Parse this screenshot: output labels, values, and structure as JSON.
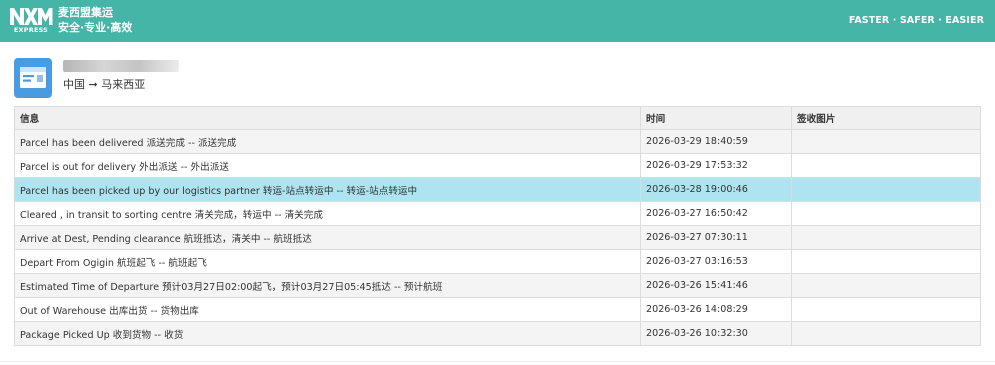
{
  "header": {
    "logo_text": "NXM",
    "logo_sub": "EXPRESS",
    "brand_name": "麦西盟集运",
    "slogan": "安全·专业·高效",
    "tagline": "FASTER · SAFER · EASIER",
    "background_color": "#44b5a6"
  },
  "shipment": {
    "icon": "package-card-icon",
    "tracking_number": "",
    "route": "中国 ➞ 马来西亚"
  },
  "table": {
    "columns": [
      "信息",
      "时间",
      "签收图片"
    ],
    "highlight_color": "#ade4f0",
    "rows": [
      {
        "info": "Parcel has been delivered 派送完成 -- 派送完成",
        "time": "2026-03-29 18:40:59",
        "sign": ""
      },
      {
        "info": "Parcel is out for delivery 外出派送 -- 外出派送",
        "time": "2026-03-29 17:53:32",
        "sign": ""
      },
      {
        "info": "Parcel has been picked up by our logistics partner 转运-站点转运中 -- 转运-站点转运中",
        "time": "2026-03-28 19:00:46",
        "sign": ""
      },
      {
        "info": "Cleared , in transit to sorting centre 清关完成，转运中 -- 清关完成",
        "time": "2026-03-27 16:50:42",
        "sign": ""
      },
      {
        "info": "Arrive at Dest, Pending clearance 航班抵达，清关中 -- 航班抵达",
        "time": "2026-03-27 07:30:11",
        "sign": ""
      },
      {
        "info": "Depart From Ogigin 航班起飞 -- 航班起飞",
        "time": "2026-03-27 03:16:53",
        "sign": ""
      },
      {
        "info": "Estimated Time of Departure 预计03月27日02:00起飞，预计03月27日05:45抵达 -- 预计航班",
        "time": "2026-03-26 15:41:46",
        "sign": ""
      },
      {
        "info": "Out of Warehouse 出库出货 -- 货物出库",
        "time": "2026-03-26 14:08:29",
        "sign": ""
      },
      {
        "info": "Package Picked Up 收到货物 -- 收货",
        "time": "2026-03-26 10:32:30",
        "sign": ""
      }
    ]
  }
}
